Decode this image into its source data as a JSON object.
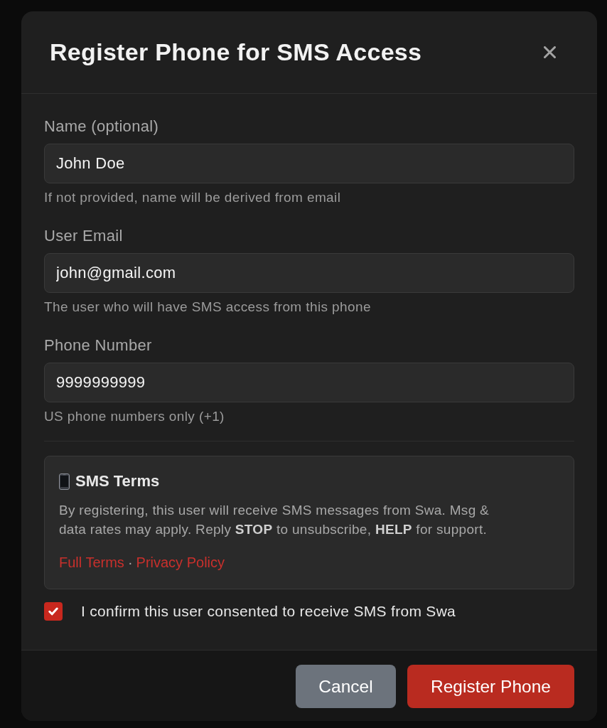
{
  "modal": {
    "title": "Register Phone for SMS Access"
  },
  "fields": [
    {
      "label": "Name (optional)",
      "value": "John Doe",
      "help": "If not provided, name will be derived from email"
    },
    {
      "label": "User Email",
      "value": "john@gmail.com",
      "help": "The user who will have SMS access from this phone"
    },
    {
      "label": "Phone Number",
      "value": "9999999999",
      "help": "US phone numbers only (+1)"
    }
  ],
  "terms": {
    "title": "SMS Terms",
    "text": "By registering, this user will receive SMS messages from Swa. Msg & data rates may apply. Reply **STOP** to unsubscribe, **HELP** for support.",
    "links": [
      "Full Terms",
      "Privacy Policy"
    ],
    "separator": "·"
  },
  "consent": {
    "checked": true,
    "label": "I confirm this user consented to receive SMS from Swa"
  },
  "buttons": [
    {
      "label": "Cancel",
      "kind": "secondary"
    },
    {
      "label": "Register Phone",
      "kind": "primary"
    }
  ]
}
